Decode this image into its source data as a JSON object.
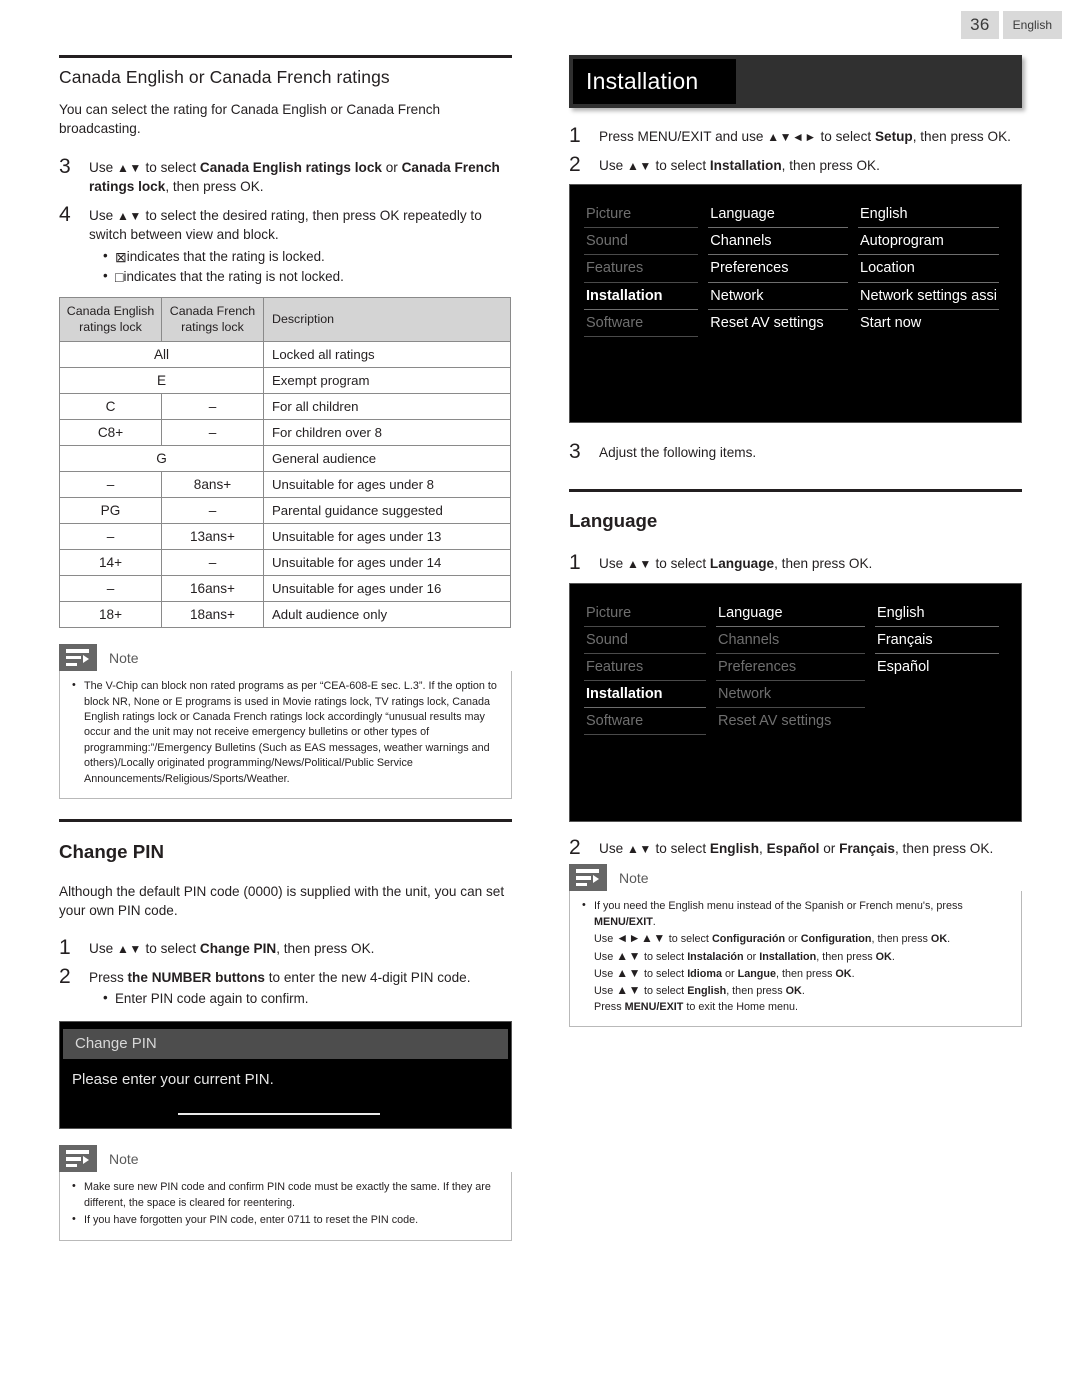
{
  "header": {
    "page_number": "36",
    "language_badge": "English"
  },
  "left_column": {
    "section_title": "Canada English or Canada French ratings",
    "intro": "You can select the rating for Canada English or Canada French broadcasting.",
    "steps": [
      {
        "num": "3",
        "text_parts": [
          {
            "t": "Use ",
            "b": false
          },
          {
            "t": "▲▼",
            "b": false,
            "arrow": true
          },
          {
            "t": " to select ",
            "b": false
          },
          {
            "t": "Canada English ratings lock",
            "b": true
          },
          {
            "t": " or ",
            "b": false
          },
          {
            "t": "Canada French ratings lock",
            "b": true
          },
          {
            "t": ", then press OK.",
            "b": false
          }
        ]
      },
      {
        "num": "4",
        "text_parts": [
          {
            "t": "Use ",
            "b": false
          },
          {
            "t": "▲▼",
            "b": false,
            "arrow": true
          },
          {
            "t": " to select the desired rating, then press OK repeatedly to switch between view and block.",
            "b": false
          }
        ],
        "bullets": [
          {
            "glyph": "⊠",
            "text": "indicates that the rating is locked."
          },
          {
            "glyph": "□",
            "text": "indicates that the rating is not locked."
          }
        ]
      }
    ],
    "ratings_table": {
      "headers": [
        "Canada English ratings lock",
        "Canada French ratings lock",
        "Description"
      ],
      "rows": [
        {
          "eng": "All",
          "fre": "",
          "span": true,
          "desc": "Locked all ratings"
        },
        {
          "eng": "E",
          "fre": "",
          "span": true,
          "desc": "Exempt program"
        },
        {
          "eng": "C",
          "fre": "–",
          "span": false,
          "desc": "For all children"
        },
        {
          "eng": "C8+",
          "fre": "–",
          "span": false,
          "desc": "For children over 8"
        },
        {
          "eng": "G",
          "fre": "",
          "span": true,
          "desc": "General audience"
        },
        {
          "eng": "–",
          "fre": "8ans+",
          "span": false,
          "desc": "Unsuitable for ages under 8"
        },
        {
          "eng": "PG",
          "fre": "–",
          "span": false,
          "desc": "Parental guidance suggested"
        },
        {
          "eng": "–",
          "fre": "13ans+",
          "span": false,
          "desc": "Unsuitable for ages under 13"
        },
        {
          "eng": "14+",
          "fre": "–",
          "span": false,
          "desc": "Unsuitable for ages under 14"
        },
        {
          "eng": "–",
          "fre": "16ans+",
          "span": false,
          "desc": "Unsuitable for ages under 16"
        },
        {
          "eng": "18+",
          "fre": "18ans+",
          "span": false,
          "desc": "Adult audience only"
        }
      ]
    },
    "note1": {
      "label": "Note",
      "items": [
        "The V-Chip can block non rated programs as per “CEA-608-E sec. L.3”. If the option to block NR, None or E programs is used in Movie ratings lock, TV ratings lock, Canada English ratings lock or Canada French ratings lock accordingly “unusual results may occur and the unit may not receive emergency bulletins or other types of programming:”/Emergency Bulletins (Such as EAS messages, weather warnings and others)/Locally originated programming/News/Political/Public Service Announcements/Religious/Sports/Weather."
      ]
    },
    "change_pin": {
      "title": "Change PIN",
      "intro": "Although the default PIN code (0000) is supplied with the unit, you can set your own PIN code.",
      "steps": [
        {
          "num": "1",
          "text_parts": [
            {
              "t": "Use ",
              "b": false
            },
            {
              "t": "▲▼",
              "b": false,
              "arrow": true
            },
            {
              "t": " to select ",
              "b": false
            },
            {
              "t": "Change PIN",
              "b": true
            },
            {
              "t": ", then press OK.",
              "b": false
            }
          ]
        },
        {
          "num": "2",
          "text_parts": [
            {
              "t": "Press ",
              "b": false
            },
            {
              "t": "the NUMBER buttons",
              "b": true
            },
            {
              "t": " to enter the new 4-digit PIN code.",
              "b": false
            }
          ],
          "bullets": [
            {
              "glyph": "",
              "text": "Enter PIN code again to confirm."
            }
          ]
        }
      ],
      "tv_dialog": {
        "title": "Change PIN",
        "message": "Please enter your current PIN."
      },
      "note": {
        "label": "Note",
        "items": [
          "Make sure new PIN code and confirm PIN code must be exactly the same. If they are different, the space is cleared for reentering.",
          "If you have forgotten your PIN code, enter 0711 to reset the PIN code."
        ]
      }
    }
  },
  "right_column": {
    "banner_title": "Installation",
    "steps": [
      {
        "num": "1",
        "text_parts": [
          {
            "t": "Press MENU/EXIT and use ",
            "b": false
          },
          {
            "t": "▲▼◄►",
            "b": false,
            "arrow": true
          },
          {
            "t": " to select ",
            "b": false
          },
          {
            "t": "Setup",
            "b": true
          },
          {
            "t": ", then press OK.",
            "b": false
          }
        ]
      },
      {
        "num": "2",
        "text_parts": [
          {
            "t": "Use ",
            "b": false
          },
          {
            "t": "▲▼",
            "b": false,
            "arrow": true
          },
          {
            "t": " to select ",
            "b": false
          },
          {
            "t": "Installation",
            "b": true
          },
          {
            "t": ", then press OK.",
            "b": false
          }
        ]
      }
    ],
    "tv_menu_1": {
      "col1": [
        {
          "label": "Picture",
          "state": "dim"
        },
        {
          "label": "Sound",
          "state": "dim"
        },
        {
          "label": "Features",
          "state": "dim"
        },
        {
          "label": "Installation",
          "state": "selected"
        },
        {
          "label": "Software",
          "state": "dim"
        }
      ],
      "col2": [
        {
          "label": "Language",
          "state": "normal"
        },
        {
          "label": "Channels",
          "state": "normal"
        },
        {
          "label": "Preferences",
          "state": "normal"
        },
        {
          "label": "Network",
          "state": "normal"
        },
        {
          "label": "Reset AV settings",
          "state": "last"
        }
      ],
      "col3": [
        {
          "label": "English",
          "state": "normal"
        },
        {
          "label": "Autoprogram",
          "state": "normal"
        },
        {
          "label": "Location",
          "state": "normal"
        },
        {
          "label": "Network settings assi",
          "state": "normal"
        },
        {
          "label": "Start now",
          "state": "last"
        }
      ]
    },
    "step3": {
      "num": "3",
      "text_parts": [
        {
          "t": "Adjust the following items.",
          "b": false
        }
      ]
    },
    "language_section": {
      "title": "Language",
      "step1": {
        "num": "1",
        "text_parts": [
          {
            "t": "Use ",
            "b": false
          },
          {
            "t": "▲▼",
            "b": false,
            "arrow": true
          },
          {
            "t": " to select ",
            "b": false
          },
          {
            "t": "Language",
            "b": true
          },
          {
            "t": ", then press OK.",
            "b": false
          }
        ]
      },
      "tv_menu_2": {
        "col1": [
          {
            "label": "Picture",
            "state": "dim"
          },
          {
            "label": "Sound",
            "state": "dim"
          },
          {
            "label": "Features",
            "state": "dim"
          },
          {
            "label": "Installation",
            "state": "selected"
          },
          {
            "label": "Software",
            "state": "dim"
          }
        ],
        "col2": [
          {
            "label": "Language",
            "state": "normal"
          },
          {
            "label": "Channels",
            "state": "dim"
          },
          {
            "label": "Preferences",
            "state": "dim"
          },
          {
            "label": "Network",
            "state": "dim"
          },
          {
            "label": "Reset AV settings",
            "state": "dimlast"
          }
        ],
        "col3": [
          {
            "label": "English",
            "state": "normal"
          },
          {
            "label": "Français",
            "state": "normal"
          },
          {
            "label": "Español",
            "state": "last"
          },
          {
            "label": "",
            "state": "hidden"
          },
          {
            "label": "",
            "state": "hidden"
          }
        ]
      },
      "step2": {
        "num": "2",
        "text_parts": [
          {
            "t": "Use ",
            "b": false
          },
          {
            "t": "▲▼",
            "b": false,
            "arrow": true
          },
          {
            "t": " to select ",
            "b": false
          },
          {
            "t": "English",
            "b": true
          },
          {
            "t": ", ",
            "b": false
          },
          {
            "t": "Español",
            "b": true
          },
          {
            "t": " or ",
            "b": false
          },
          {
            "t": "Français",
            "b": true
          },
          {
            "t": ", then press OK.",
            "b": false
          }
        ]
      },
      "note": {
        "label": "Note",
        "lines": [
          [
            {
              "t": "If you need the English menu instead of the Spanish or French menu's, press ",
              "b": false
            },
            {
              "t": "MENU/EXIT",
              "b": true
            },
            {
              "t": ".",
              "b": false
            }
          ],
          [
            {
              "t": "Use ",
              "b": false
            },
            {
              "t": "◄►▲▼",
              "b": false,
              "arrow": true
            },
            {
              "t": " to select ",
              "b": false
            },
            {
              "t": "Configuración",
              "b": true
            },
            {
              "t": " or ",
              "b": false
            },
            {
              "t": "Configuration",
              "b": true
            },
            {
              "t": ", then press ",
              "b": false
            },
            {
              "t": "OK",
              "b": true
            },
            {
              "t": ".",
              "b": false
            }
          ],
          [
            {
              "t": "Use ",
              "b": false
            },
            {
              "t": "▲▼",
              "b": false,
              "arrow": true
            },
            {
              "t": " to select ",
              "b": false
            },
            {
              "t": "Instalación",
              "b": true
            },
            {
              "t": " or ",
              "b": false
            },
            {
              "t": "Installation",
              "b": true
            },
            {
              "t": ", then press ",
              "b": false
            },
            {
              "t": "OK",
              "b": true
            },
            {
              "t": ".",
              "b": false
            }
          ],
          [
            {
              "t": "Use ",
              "b": false
            },
            {
              "t": "▲▼",
              "b": false,
              "arrow": true
            },
            {
              "t": " to select ",
              "b": false
            },
            {
              "t": "Idioma",
              "b": true
            },
            {
              "t": " or ",
              "b": false
            },
            {
              "t": "Langue",
              "b": true
            },
            {
              "t": ", then press ",
              "b": false
            },
            {
              "t": "OK",
              "b": true
            },
            {
              "t": ".",
              "b": false
            }
          ],
          [
            {
              "t": "Use ",
              "b": false
            },
            {
              "t": "▲▼",
              "b": false,
              "arrow": true
            },
            {
              "t": " to select ",
              "b": false
            },
            {
              "t": "English",
              "b": true
            },
            {
              "t": ", then press ",
              "b": false
            },
            {
              "t": "OK",
              "b": true
            },
            {
              "t": ".",
              "b": false
            }
          ],
          [
            {
              "t": "Press ",
              "b": false
            },
            {
              "t": "MENU/EXIT",
              "b": true
            },
            {
              "t": " to exit the Home menu.",
              "b": false
            }
          ]
        ]
      }
    }
  }
}
